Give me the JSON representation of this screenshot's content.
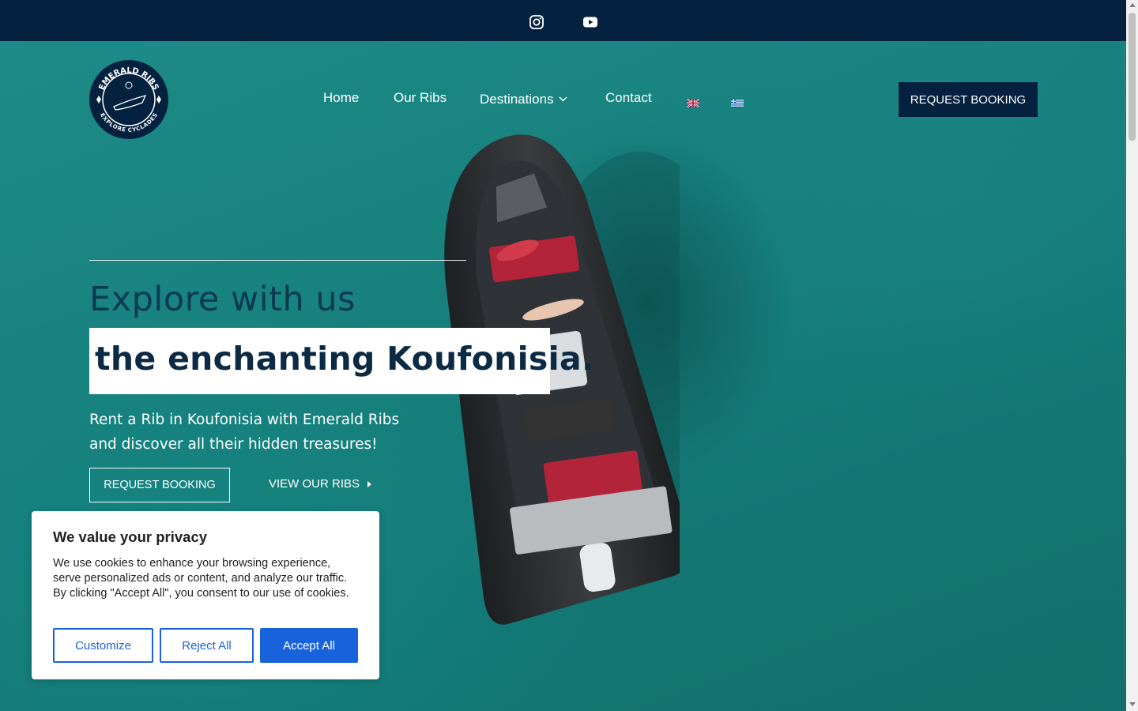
{
  "topbar": {
    "social": [
      {
        "icon": "instagram-icon"
      },
      {
        "icon": "youtube-icon"
      }
    ]
  },
  "logo": {
    "top_text": "EMERALD RIBS",
    "bottom_text": "EXPLORE CYCLADES"
  },
  "nav": {
    "items": [
      "Home",
      "Our Ribs",
      "Destinations",
      "Contact"
    ],
    "languages": [
      "English",
      "Greek"
    ]
  },
  "header": {
    "cta_label": "REQUEST BOOKING"
  },
  "hero": {
    "title_line1": "Explore with us",
    "title_line2": "the enchanting Koufonisia.",
    "subtitle_line1": "Rent a Rib in Koufonisia with Emerald Ribs",
    "subtitle_line2": "and discover all their hidden treasures!",
    "primary_button": "REQUEST BOOKING",
    "secondary_link": "VIEW OUR RIBS"
  },
  "cookie": {
    "title": "We value your privacy",
    "text": "We use cookies to enhance your browsing experience, serve personalized ads or content, and analyze our traffic. By clicking \"Accept All\", you consent to our use of cookies.",
    "customize": "Customize",
    "reject": "Reject All",
    "accept": "Accept All"
  },
  "colors": {
    "navy": "#04213f",
    "sea": "#177a78",
    "cookie_blue": "#1863dc"
  }
}
